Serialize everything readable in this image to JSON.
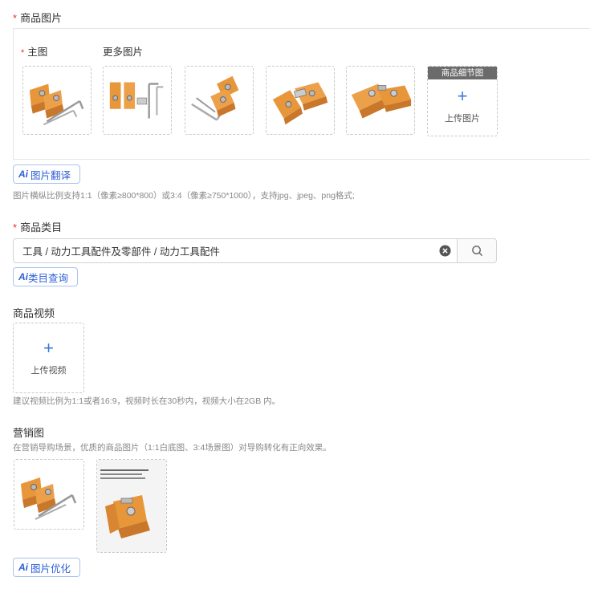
{
  "product_images": {
    "title": "商品图片",
    "main_label": "主图",
    "more_label": "更多图片",
    "detail_tag": "商品细节图",
    "upload_text": "上传图片",
    "upload_icon": "plus-icon",
    "ai_badge": "Ai",
    "ai_button": "图片翻译",
    "hint": "图片横纵比例支持1:1（像素≥800*800）或3:4（像素≥750*1000），支持jpg、jpeg、png格式;"
  },
  "category": {
    "title": "商品类目",
    "value": "工具 / 动力工具配件及零部件 / 动力工具配件",
    "clear_icon": "clear-circle-icon",
    "search_icon": "search-icon",
    "ai_badge": "Ai",
    "ai_button": "类目查询"
  },
  "video": {
    "title": "商品视频",
    "upload_icon": "plus-icon",
    "upload_text": "上传视频",
    "hint": "建议视频比例为1:1或者16:9，视频时长在30秒内，视频大小在2GB 内。"
  },
  "marketing": {
    "title": "营销图",
    "hint": "在营销导购场景，优质的商品图片（1:1白底图、3:4场景图）对导购转化有正向效果。",
    "ai_badge": "Ai",
    "ai_button": "图片优化"
  },
  "colors": {
    "required": "#e0342b",
    "accent": "#2c5fd6",
    "product_orange": "#e8963a"
  }
}
